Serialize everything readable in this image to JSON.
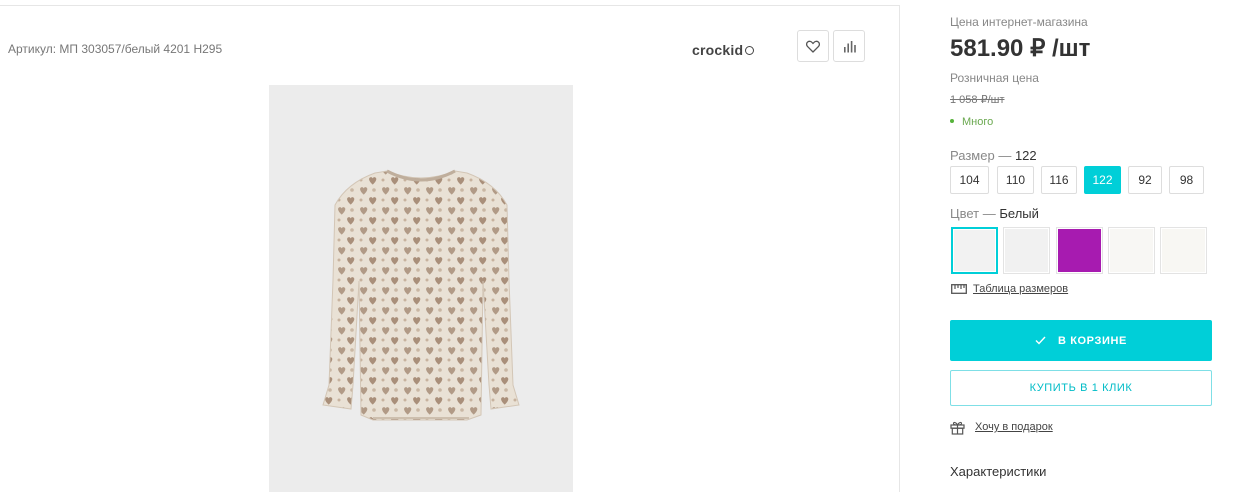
{
  "product": {
    "article": "Артикул: МП 303057/белый 4201 Н295",
    "brand": "crockid"
  },
  "price": {
    "online_label": "Цена интернет-магазина",
    "online_value": "581.90 ₽ /шт",
    "retail_label": "Розничная цена",
    "retail_value": "1 058 ₽/шт",
    "stock": "Много"
  },
  "size": {
    "label": "Размер",
    "dash": "—",
    "selected": "122",
    "options": [
      "104",
      "110",
      "116",
      "122",
      "92",
      "98"
    ]
  },
  "color": {
    "label": "Цвет",
    "dash": "—",
    "selected": "Белый",
    "swatches": [
      "#f2f2f2",
      "#f1f1f1",
      "#a71bb0",
      "#f8f7f4",
      "#f8f7f3"
    ]
  },
  "links": {
    "size_table": "Таблица размеров",
    "gift": "Хочу в подарок"
  },
  "buttons": {
    "cart": "В КОРЗИНЕ",
    "one_click": "КУПИТЬ В 1 КЛИК"
  },
  "section": {
    "characteristics": "Характеристики"
  },
  "colors": {
    "accent": "#00cfd8",
    "stock": "#56b33b"
  }
}
